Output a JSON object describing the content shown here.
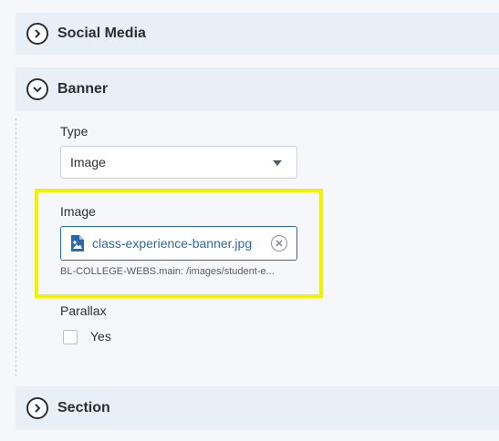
{
  "panels": {
    "social_media": {
      "title": "Social Media",
      "icon": "chevron-right-icon"
    },
    "banner": {
      "title": "Banner",
      "icon": "chevron-down-icon"
    },
    "section": {
      "title": "Section",
      "icon": "chevron-right-icon"
    }
  },
  "banner": {
    "type_label": "Type",
    "type_value": "Image",
    "image_label": "Image",
    "image_file_name": "class-experience-banner.jpg",
    "image_path": "BL-COLLEGE-WEBS.main: /images/student-e...",
    "parallax_label": "Parallax",
    "parallax_option_label": "Yes",
    "parallax_checked": false
  },
  "colors": {
    "panel_header_bg": "#e9eff6",
    "link_blue": "#2d6aa5",
    "highlight_yellow": "#f2f200"
  }
}
